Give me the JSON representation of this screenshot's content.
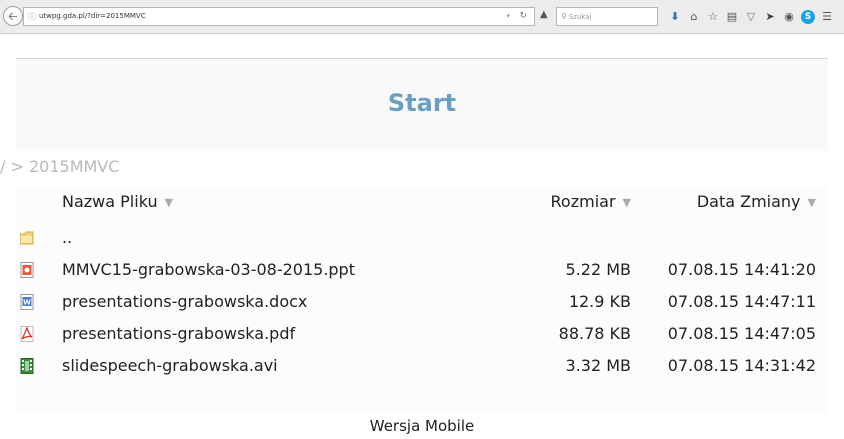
{
  "browser": {
    "url": "utwpg.gda.pl/?dir=2015MMVC",
    "search_placeholder": "Szukaj",
    "icons": [
      "download-icon",
      "home-icon",
      "bookmark-star-icon",
      "library-icon",
      "pocket-icon",
      "send-icon",
      "circle-icon",
      "skype-icon",
      "menu-icon"
    ]
  },
  "page": {
    "title": "Start",
    "breadcrumb": "/ > 2015MMVC",
    "columns": {
      "name": "Nazwa Pliku",
      "size": "Rozmiar",
      "date": "Data Zmiany"
    },
    "files": [
      {
        "name": "..",
        "size": "",
        "date": "",
        "icon": "folder-icon"
      },
      {
        "name": "MMVC15-grabowska-03-08-2015.ppt",
        "size": "5.22 MB",
        "date": "07.08.15 14:41:20",
        "icon": "ppt-file-icon"
      },
      {
        "name": "presentations-grabowska.docx",
        "size": "12.9 KB",
        "date": "07.08.15 14:47:11",
        "icon": "doc-file-icon"
      },
      {
        "name": "presentations-grabowska.pdf",
        "size": "88.78 KB",
        "date": "07.08.15 14:47:05",
        "icon": "pdf-file-icon"
      },
      {
        "name": "slidespeech-grabowska.avi",
        "size": "3.32 MB",
        "date": "07.08.15 14:31:42",
        "icon": "video-file-icon"
      }
    ],
    "footer_link": "Wersja Mobile"
  }
}
